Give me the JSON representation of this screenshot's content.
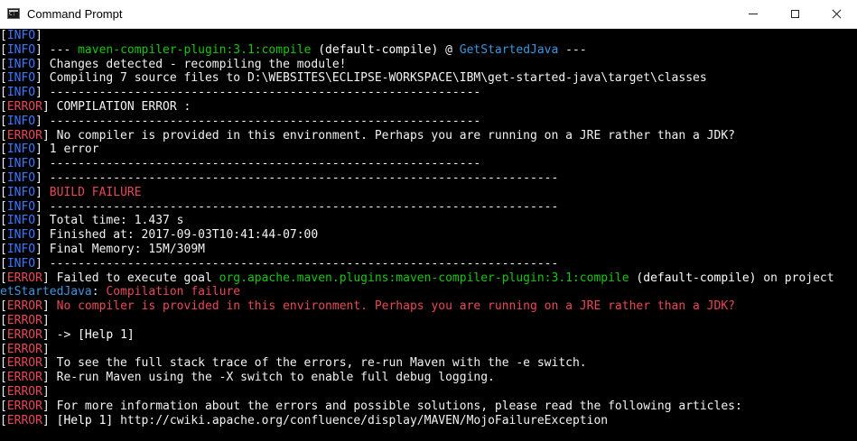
{
  "window": {
    "title": "Command Prompt"
  },
  "console": {
    "lines": [
      [
        {
          "t": "[",
          "c": "white"
        },
        {
          "t": "INFO",
          "c": "info"
        },
        {
          "t": "]",
          "c": "white"
        }
      ],
      [
        {
          "t": "[",
          "c": "white"
        },
        {
          "t": "INFO",
          "c": "info"
        },
        {
          "t": "] --- ",
          "c": "white"
        },
        {
          "t": "maven-compiler-plugin:3.1:compile",
          "c": "green"
        },
        {
          "t": " (default-compile)",
          "c": "bold"
        },
        {
          "t": " @ ",
          "c": "white"
        },
        {
          "t": "GetStartedJava",
          "c": "cyan"
        },
        {
          "t": " ---",
          "c": "white"
        }
      ],
      [
        {
          "t": "[",
          "c": "white"
        },
        {
          "t": "INFO",
          "c": "info"
        },
        {
          "t": "] Changes detected - recompiling the module!",
          "c": "white"
        }
      ],
      [
        {
          "t": "[",
          "c": "white"
        },
        {
          "t": "INFO",
          "c": "info"
        },
        {
          "t": "] Compiling 7 source files to D:\\WEBSITES\\ECLIPSE-WORKSPACE\\IBM\\get-started-java\\target\\classes",
          "c": "white"
        }
      ],
      [
        {
          "t": "[",
          "c": "white"
        },
        {
          "t": "INFO",
          "c": "info"
        },
        {
          "t": "] -------------------------------------------------------------",
          "c": "white"
        }
      ],
      [
        {
          "t": "[",
          "c": "white"
        },
        {
          "t": "ERROR",
          "c": "error"
        },
        {
          "t": "] COMPILATION ERROR :",
          "c": "white"
        }
      ],
      [
        {
          "t": "[",
          "c": "white"
        },
        {
          "t": "INFO",
          "c": "info"
        },
        {
          "t": "] -------------------------------------------------------------",
          "c": "white"
        }
      ],
      [
        {
          "t": "[",
          "c": "white"
        },
        {
          "t": "ERROR",
          "c": "error"
        },
        {
          "t": "] No compiler is provided in this environment. Perhaps you are running on a JRE rather than a JDK?",
          "c": "white"
        }
      ],
      [
        {
          "t": "[",
          "c": "white"
        },
        {
          "t": "INFO",
          "c": "info"
        },
        {
          "t": "] 1 error",
          "c": "white"
        }
      ],
      [
        {
          "t": "[",
          "c": "white"
        },
        {
          "t": "INFO",
          "c": "info"
        },
        {
          "t": "] -------------------------------------------------------------",
          "c": "white"
        }
      ],
      [
        {
          "t": "[",
          "c": "white"
        },
        {
          "t": "INFO",
          "c": "info"
        },
        {
          "t": "] ------------------------------------------------------------------------",
          "c": "white"
        }
      ],
      [
        {
          "t": "[",
          "c": "white"
        },
        {
          "t": "INFO",
          "c": "info"
        },
        {
          "t": "] ",
          "c": "white"
        },
        {
          "t": "BUILD FAILURE",
          "c": "red"
        }
      ],
      [
        {
          "t": "[",
          "c": "white"
        },
        {
          "t": "INFO",
          "c": "info"
        },
        {
          "t": "] ------------------------------------------------------------------------",
          "c": "white"
        }
      ],
      [
        {
          "t": "[",
          "c": "white"
        },
        {
          "t": "INFO",
          "c": "info"
        },
        {
          "t": "] Total time: 1.437 s",
          "c": "white"
        }
      ],
      [
        {
          "t": "[",
          "c": "white"
        },
        {
          "t": "INFO",
          "c": "info"
        },
        {
          "t": "] Finished at: 2017-09-03T10:41:44-07:00",
          "c": "white"
        }
      ],
      [
        {
          "t": "[",
          "c": "white"
        },
        {
          "t": "INFO",
          "c": "info"
        },
        {
          "t": "] Final Memory: 15M/309M",
          "c": "white"
        }
      ],
      [
        {
          "t": "[",
          "c": "white"
        },
        {
          "t": "INFO",
          "c": "info"
        },
        {
          "t": "] ------------------------------------------------------------------------",
          "c": "white"
        }
      ],
      [
        {
          "t": "[",
          "c": "white"
        },
        {
          "t": "ERROR",
          "c": "error"
        },
        {
          "t": "] Failed to execute goal ",
          "c": "white"
        },
        {
          "t": "org.apache.maven.plugins:maven-compiler-plugin:3.1:compile",
          "c": "green"
        },
        {
          "t": " (default-compile)",
          "c": "bold"
        },
        {
          "t": " on project",
          "c": "white"
        }
      ],
      [
        {
          "t": "etStartedJava",
          "c": "cyan"
        },
        {
          "t": ": ",
          "c": "white"
        },
        {
          "t": "Compilation failure",
          "c": "red"
        }
      ],
      [
        {
          "t": "[",
          "c": "white"
        },
        {
          "t": "ERROR",
          "c": "error"
        },
        {
          "t": "] ",
          "c": "white"
        },
        {
          "t": "No compiler is provided in this environment. Perhaps you are running on a JRE rather than a JDK?",
          "c": "red"
        }
      ],
      [
        {
          "t": "[",
          "c": "white"
        },
        {
          "t": "ERROR",
          "c": "error"
        },
        {
          "t": "]",
          "c": "white"
        }
      ],
      [
        {
          "t": "[",
          "c": "white"
        },
        {
          "t": "ERROR",
          "c": "error"
        },
        {
          "t": "] -> ",
          "c": "white"
        },
        {
          "t": "[Help 1]",
          "c": "bold"
        }
      ],
      [
        {
          "t": "[",
          "c": "white"
        },
        {
          "t": "ERROR",
          "c": "error"
        },
        {
          "t": "]",
          "c": "white"
        }
      ],
      [
        {
          "t": "[",
          "c": "white"
        },
        {
          "t": "ERROR",
          "c": "error"
        },
        {
          "t": "] To see the full stack trace of the errors, re-run Maven with the -e switch.",
          "c": "white"
        }
      ],
      [
        {
          "t": "[",
          "c": "white"
        },
        {
          "t": "ERROR",
          "c": "error"
        },
        {
          "t": "] Re-run Maven using the -X switch to enable full debug logging.",
          "c": "white"
        }
      ],
      [
        {
          "t": "[",
          "c": "white"
        },
        {
          "t": "ERROR",
          "c": "error"
        },
        {
          "t": "]",
          "c": "white"
        }
      ],
      [
        {
          "t": "[",
          "c": "white"
        },
        {
          "t": "ERROR",
          "c": "error"
        },
        {
          "t": "] For more information about the errors and possible solutions, please read the following articles:",
          "c": "white"
        }
      ],
      [
        {
          "t": "[",
          "c": "white"
        },
        {
          "t": "ERROR",
          "c": "error"
        },
        {
          "t": "] ",
          "c": "white"
        },
        {
          "t": "[Help 1]",
          "c": "bold"
        },
        {
          "t": " http://cwiki.apache.org/confluence/display/MAVEN/MojoFailureException",
          "c": "white"
        }
      ]
    ]
  },
  "colors": {
    "background": "#000000",
    "info": "#3b78ff",
    "error": "#e74856",
    "green": "#16c60c",
    "cyan": "#3a96dd"
  }
}
